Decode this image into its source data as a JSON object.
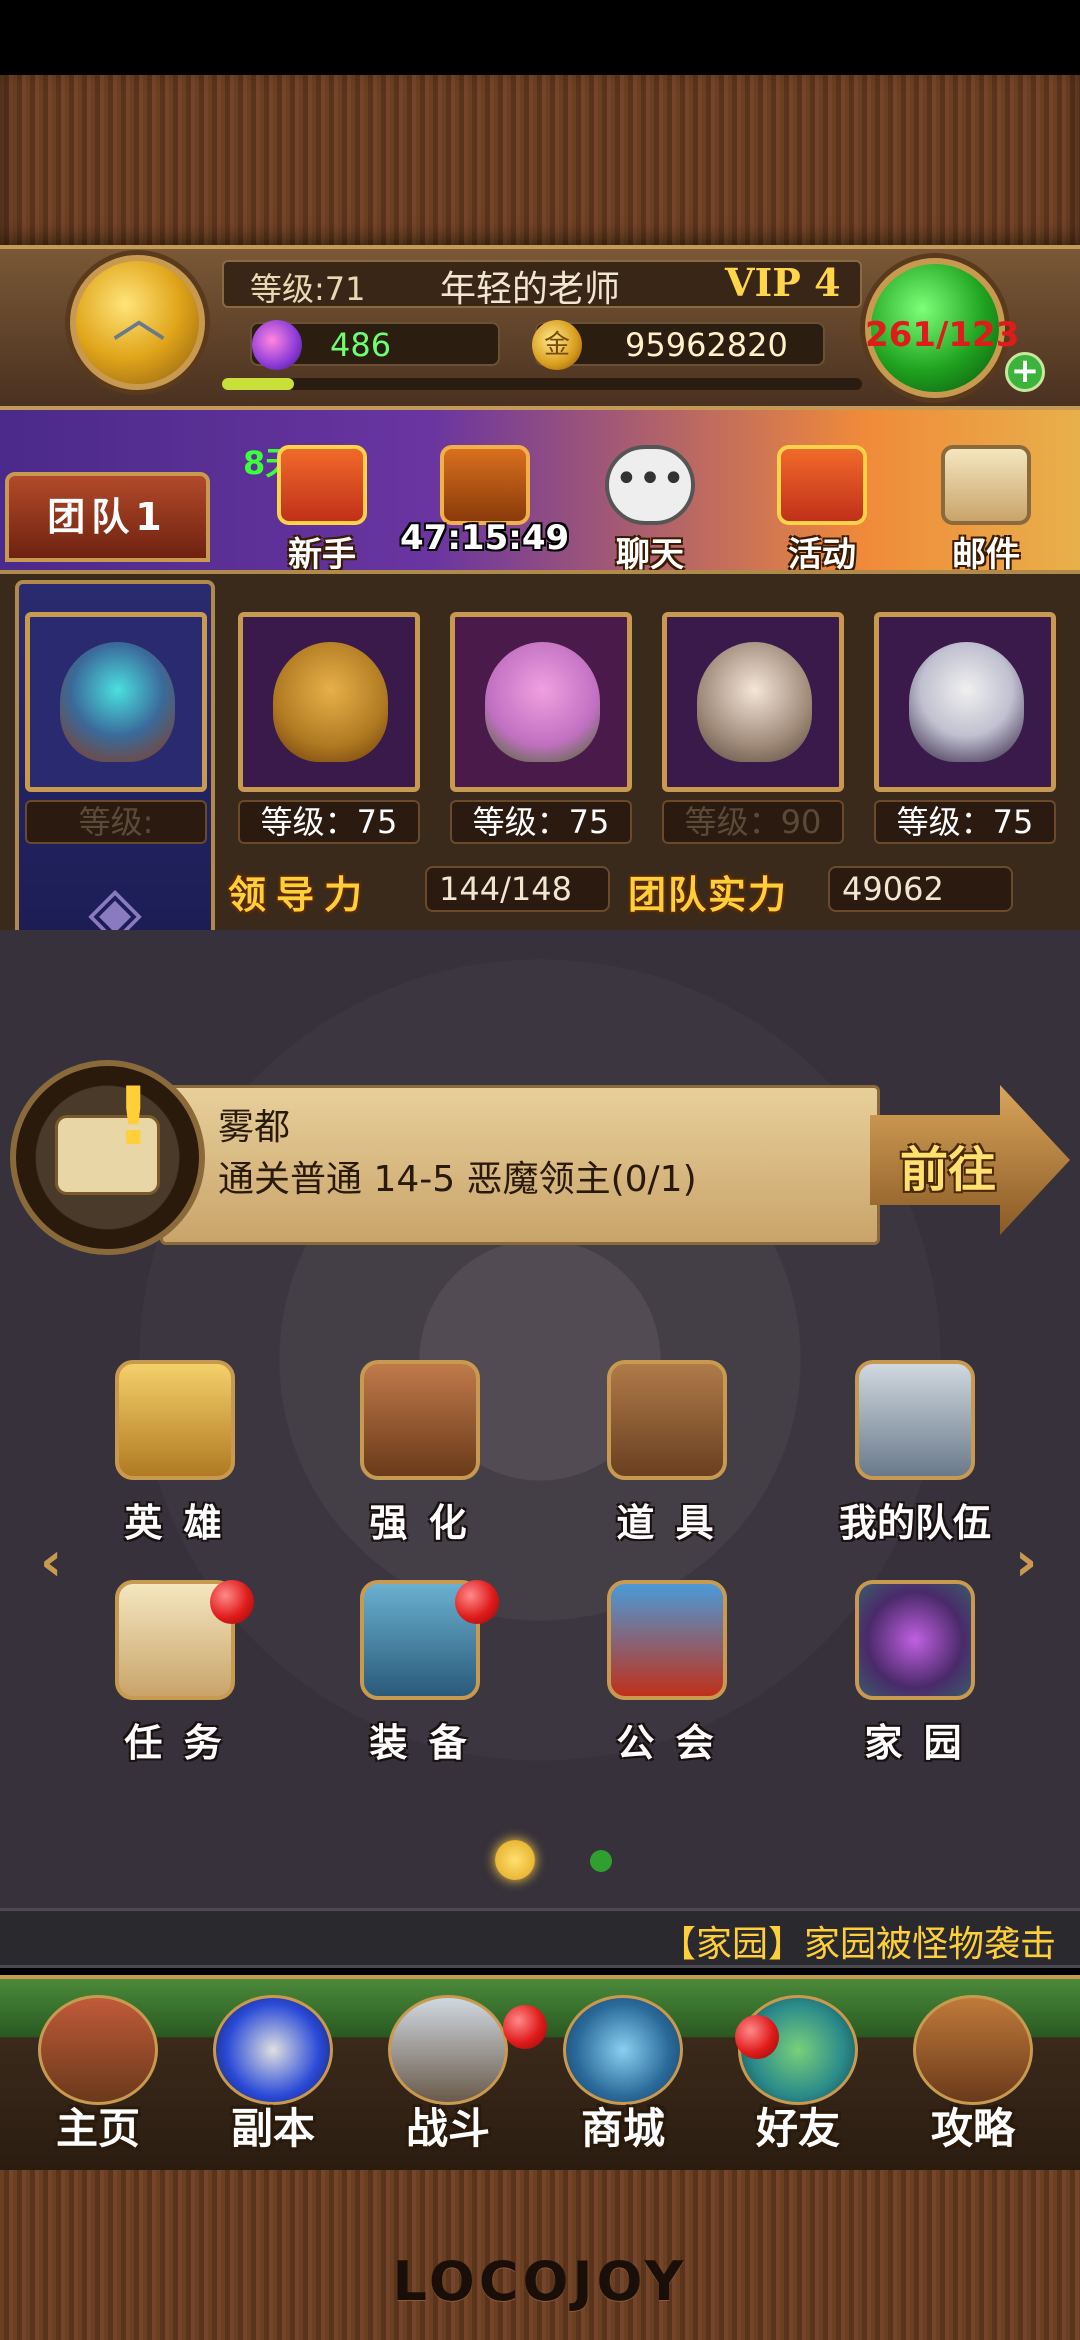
{
  "player": {
    "level_label": "等级:71",
    "name": "年轻的老师",
    "vip": "VIP 4",
    "gems": "486",
    "gold": "95962820",
    "gold_symbol": "金",
    "stamina": "261/123",
    "plus": "+"
  },
  "banner": {
    "team_tab": "团队1",
    "days": "8天",
    "timer": "47:15:49",
    "buttons": [
      {
        "label": "新手",
        "icon": "gift-icon"
      },
      {
        "label": "",
        "icon": "treasure-chest-icon"
      },
      {
        "label": "聊天",
        "icon": "chat-bubble-icon"
      },
      {
        "label": "活动",
        "icon": "gift-icon"
      },
      {
        "label": "邮件",
        "icon": "mail-icon"
      }
    ]
  },
  "team": {
    "leader_level": "等级:",
    "hero_levels": [
      "等级：75",
      "等级：75",
      "等级：90",
      "等级：75"
    ],
    "leadership_label": "领导力",
    "leadership_value": "144/148",
    "power_label": "团队实力",
    "power_value": "49062"
  },
  "quest": {
    "title": "雾都",
    "description": "通关普通 14-5 恶魔领主(0/1)",
    "go_label": "前往"
  },
  "menu": {
    "row1": [
      "英  雄",
      "强  化",
      "道  具",
      "我的队伍"
    ],
    "row2": [
      "任  务",
      "装  备",
      "公  会",
      "家  园"
    ]
  },
  "ticker": "【家园】家园被怪物袭击",
  "nav": [
    "主页",
    "副本",
    "战斗",
    "商城",
    "好友",
    "攻略"
  ],
  "logo": "LOCOJOY",
  "colors": {
    "accent_gold": "#ffcf3a",
    "gem_green": "#6dff6d",
    "hp_red": "#e01b1b"
  }
}
